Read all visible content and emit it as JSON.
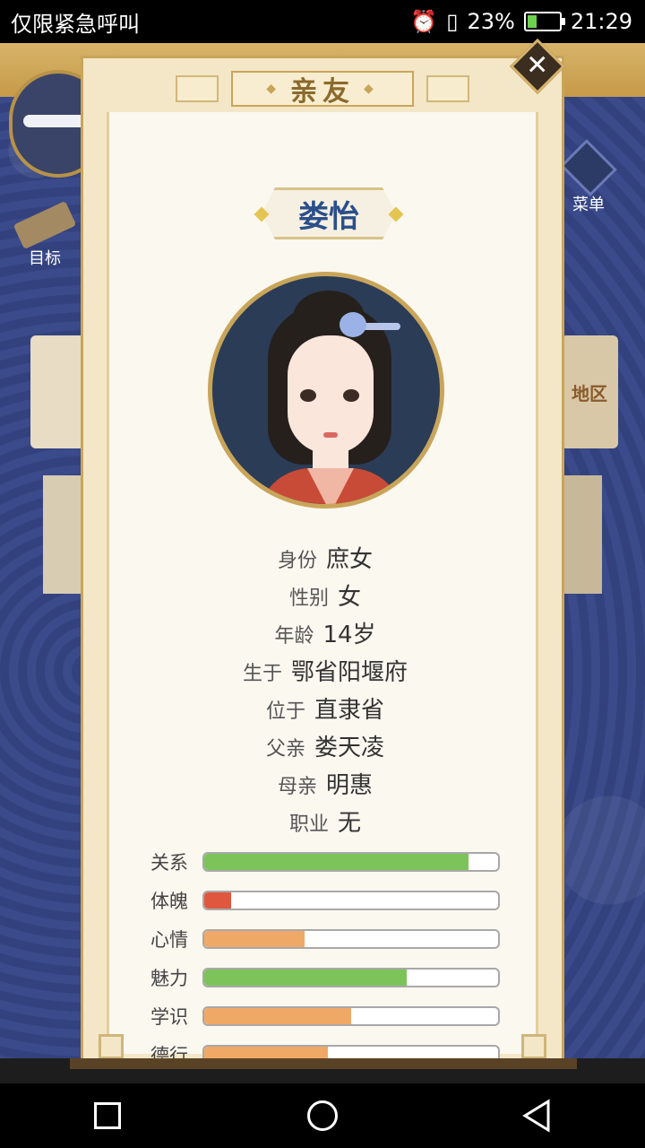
{
  "status_bar": {
    "left_text": "仅限紧急呼叫",
    "battery_percent": "23%",
    "time": "21:29",
    "icons": [
      "alarm-icon",
      "sim-icon",
      "battery-icon"
    ]
  },
  "hud": {
    "goal_label": "目标",
    "menu_label": "菜单",
    "region_label": "地区"
  },
  "dialog": {
    "title": "亲友",
    "close_icon": "close-icon"
  },
  "character": {
    "name": "娄怡",
    "info": [
      {
        "label": "身份",
        "value": "庶女"
      },
      {
        "label": "性别",
        "value": "女"
      },
      {
        "label": "年龄",
        "value": "14岁"
      },
      {
        "label": "生于",
        "value": "鄂省阳堰府"
      },
      {
        "label": "位于",
        "value": "直隶省"
      },
      {
        "label": "父亲",
        "value": "娄天凌"
      },
      {
        "label": "母亲",
        "value": "明惠"
      },
      {
        "label": "职业",
        "value": "无"
      }
    ],
    "stats": [
      {
        "label": "关系",
        "value": 0.9,
        "color": "#7cc45a"
      },
      {
        "label": "体魄",
        "value": 0.09,
        "color": "#e0573f"
      },
      {
        "label": "心情",
        "value": 0.34,
        "color": "#f0a866"
      },
      {
        "label": "魅力",
        "value": 0.69,
        "color": "#7cc45a"
      },
      {
        "label": "学识",
        "value": 0.5,
        "color": "#f0a866"
      },
      {
        "label": "德行",
        "value": 0.42,
        "color": "#f0a866"
      }
    ]
  },
  "nav": {
    "recent_icon": "square-icon",
    "home_icon": "circle-icon",
    "back_icon": "triangle-back-icon"
  }
}
